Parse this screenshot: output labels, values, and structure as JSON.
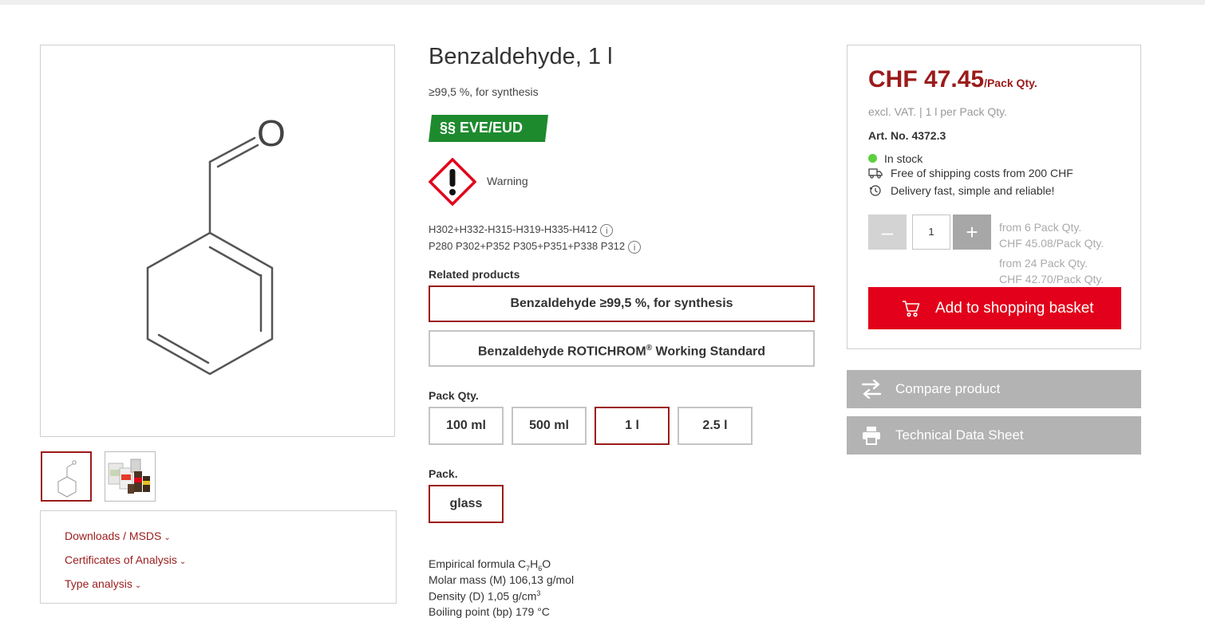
{
  "product": {
    "title": "Benzaldehyde, 1 l",
    "subtitle": "≥99,5 %, for synthesis",
    "badge": "§§ EVE/EUD",
    "hazard_label": "Warning",
    "h_statements": "H302+H332-H315-H319-H335-H412",
    "p_statements": "P280 P302+P352 P305+P351+P338 P312",
    "info_glyph": "i"
  },
  "related": {
    "label": "Related products",
    "items": [
      {
        "name": "Benzaldehyde ≥99,5 %, for synthesis"
      },
      {
        "name": "Benzaldehyde ROTICHROM",
        "sup": "®",
        "suffix": " Working Standard"
      }
    ]
  },
  "pack_qty": {
    "label": "Pack Qty.",
    "options": [
      "100 ml",
      "500 ml",
      "1 l",
      "2.5 l"
    ],
    "selected": "1 l"
  },
  "pack": {
    "label": "Pack.",
    "options": [
      "glass"
    ],
    "selected": "glass"
  },
  "properties": {
    "formula_label": "Empirical formula C",
    "formula_c": "7",
    "formula_h_sym": "H",
    "formula_h": "6",
    "formula_o": "O",
    "molar_mass": "Molar mass (M) 106,13 g/mol",
    "density_prefix": "Density (D) 1,05 g/cm",
    "density_sup": "3",
    "boiling_point": "Boiling point (bp) 179 °C"
  },
  "downloads": {
    "links": [
      "Downloads / MSDS",
      "Certificates of Analysis",
      "Type analysis"
    ],
    "chevron": "⌄"
  },
  "purchase": {
    "price": "CHF 47.45",
    "price_unit": "/Pack Qty.",
    "vat_note": "excl. VAT. | 1 l per Pack Qty.",
    "art_no": "Art. No. 4372.3",
    "stock": "In stock",
    "shipping": "Free of shipping costs from 200 CHF",
    "delivery": "Delivery fast, simple and reliable!",
    "quantity": "1",
    "minus": "–",
    "plus": "+",
    "tiers": [
      {
        "from": "from 6 Pack Qty.",
        "price": "CHF 45.08/Pack Qty."
      },
      {
        "from": "from 24 Pack Qty.",
        "price": "CHF 42.70/Pack Qty."
      }
    ],
    "basket_label": "Add to shopping basket"
  },
  "actions": {
    "compare": "Compare product",
    "data_sheet": "Technical Data Sheet"
  },
  "colors": {
    "brand_red": "#9b1b1b",
    "basket_red": "#e2001a",
    "badge_green": "#1e8a2e",
    "stock_green": "#5ccf3f",
    "action_gray": "#b3b3b3"
  },
  "icons": [
    "benzaldehyde-structure-image",
    "ghs-exclamation-icon",
    "info-icon",
    "truck-icon",
    "clock-icon",
    "cart-icon",
    "compare-arrows-icon",
    "printer-icon",
    "chevron-down-icon"
  ]
}
